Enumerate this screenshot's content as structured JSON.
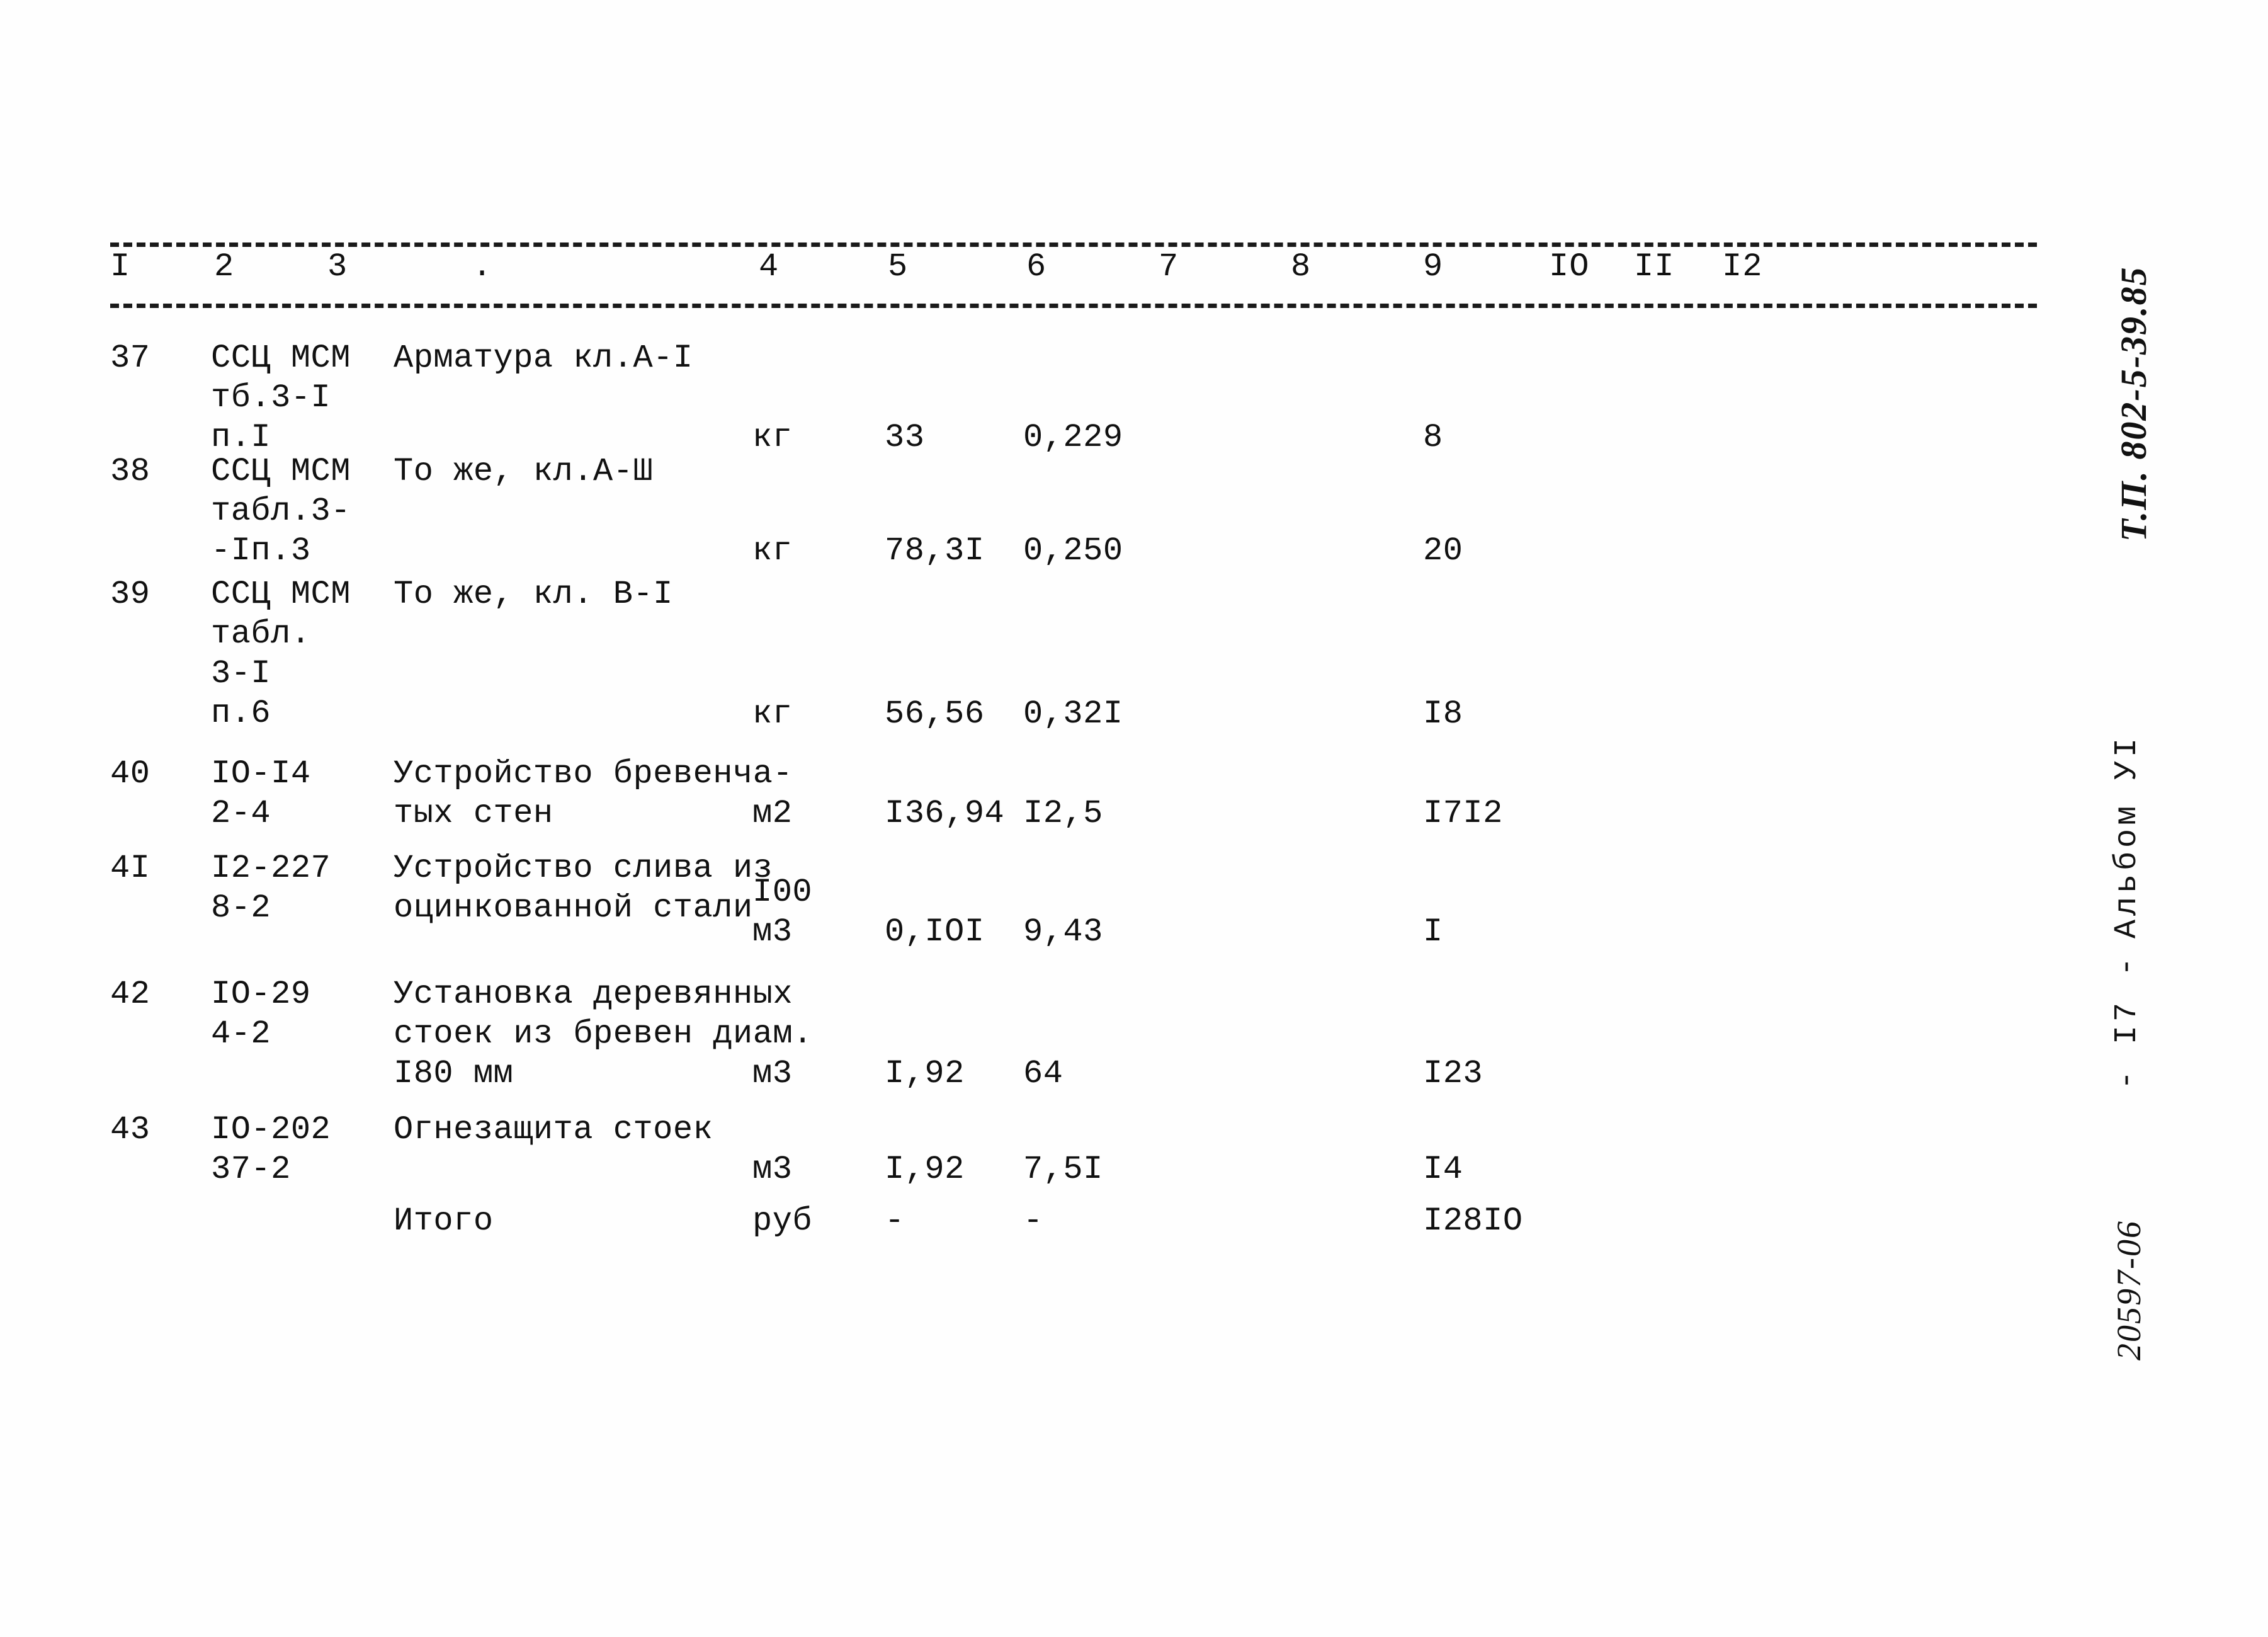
{
  "document": {
    "kind": "scanned-estimate-table",
    "language": "ru"
  },
  "table": {
    "column_numbers": [
      "I",
      "2",
      "3",
      ".",
      "4",
      "5",
      "6",
      "7",
      "8",
      "9",
      "IO",
      "II",
      "I2"
    ],
    "rows": [
      {
        "num": "37",
        "code": "ССЦ МСМ\nтб.3-I\nп.I",
        "name": "Арматура кл.А-I",
        "unit": "кг",
        "qty": "33",
        "price": "0,229",
        "total": "8"
      },
      {
        "num": "38",
        "code": "ССЦ МСМ\nтабл.3-\n-Iп.3",
        "name": "То же, кл.А-Ш",
        "unit": "кг",
        "qty": "78,3I",
        "price": "0,250",
        "total": "20"
      },
      {
        "num": "39",
        "code": "ССЦ МСМ\nтабл.\n3-I\nп.6",
        "name": "То же, кл. В-I",
        "unit": "кг",
        "qty": "56,56",
        "price": "0,32I",
        "total": "I8"
      },
      {
        "num": "40",
        "code": "IO-I4\n2-4",
        "name": "Устройство бревенча-\nтых стен",
        "unit": "м2",
        "qty": "I36,94",
        "price": "I2,5",
        "total": "I7I2"
      },
      {
        "num": "4I",
        "code": "I2-227\n8-2",
        "name": "Устройство слива из\nоцинкованной стали",
        "unit": "I00\nм3",
        "qty": "0,IOI",
        "price": "9,43",
        "total": "I"
      },
      {
        "num": "42",
        "code": "IO-29\n4-2",
        "name": "Установка деревянных\nстоек из бревен диам.\nI80 мм",
        "unit": "м3",
        "qty": "I,92",
        "price": "64",
        "total": "I23"
      },
      {
        "num": "43",
        "code": "IO-202\n37-2",
        "name": "Огнезащита стоек",
        "unit": "м3",
        "qty": "I,92",
        "price": "7,5I",
        "total": "I4"
      },
      {
        "num": "",
        "code": "",
        "name": "Итого",
        "unit": "руб",
        "qty": "-",
        "price": "-",
        "total": "I28IO"
      }
    ]
  },
  "margin_stamps": {
    "project": "Т.П. 802-5-39.85",
    "album": "Альбом УI",
    "page": "- I7 -",
    "doc_number": "20597-06"
  }
}
